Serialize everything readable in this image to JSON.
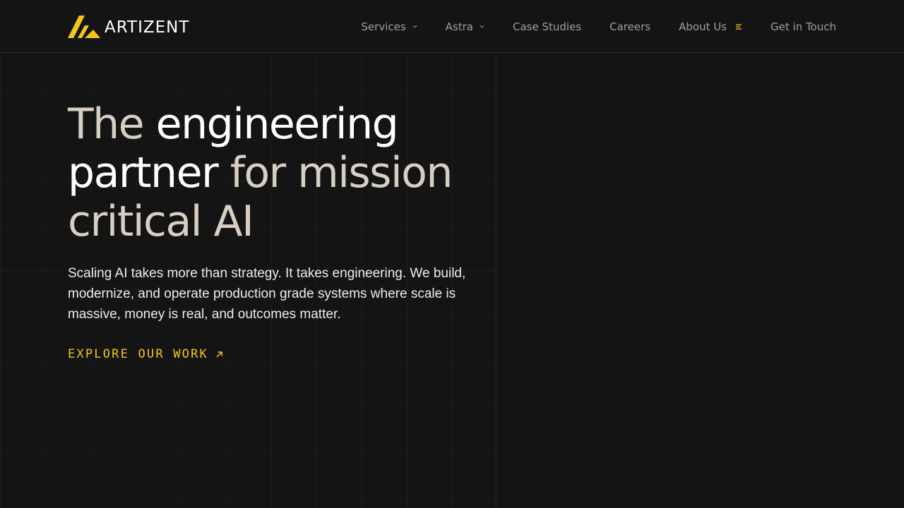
{
  "brand": {
    "name": "ARTIZENT",
    "accent_color": "#F5C518",
    "logo_icon": "artizent-logo-icon"
  },
  "nav": {
    "items": [
      {
        "label": "Services",
        "has_dropdown": true,
        "icon": "chevron-down-icon"
      },
      {
        "label": "Astra",
        "has_dropdown": true,
        "icon": "chevron-down-icon"
      },
      {
        "label": "Case Studies",
        "has_dropdown": false
      },
      {
        "label": "Careers",
        "has_dropdown": false
      },
      {
        "label": "About Us",
        "has_dropdown": false,
        "icon": "menu-lines-icon"
      },
      {
        "label": "Get in Touch",
        "has_dropdown": false
      }
    ]
  },
  "hero": {
    "headline": {
      "part1": "The ",
      "part2": "engineering",
      "part3": "partner",
      "part4": " for mission",
      "part5": "critical AI"
    },
    "subtext": "Scaling AI takes more than strategy. It takes engineering. We build, modernize, and operate production grade systems where scale is massive, money is real, and outcomes matter.",
    "cta_label": "EXPLORE OUR WORK",
    "cta_icon": "arrow-up-right-icon"
  },
  "colors": {
    "background": "#141414",
    "headline_white": "#FFFFFF",
    "headline_tan": "#D8CFC2",
    "nav_text": "#9AA0AA"
  }
}
